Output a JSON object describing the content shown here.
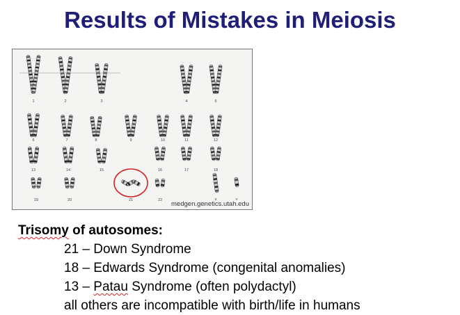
{
  "title": "Results of Mistakes in Meiosis",
  "figure": {
    "credit": "medgen.genetics.utah.edu",
    "chromosome_numbers": [
      "1",
      "2",
      "3",
      "4",
      "5",
      "6",
      "7",
      "8",
      "9",
      "10",
      "11",
      "12",
      "13",
      "14",
      "15",
      "16",
      "17",
      "18",
      "19",
      "20",
      "21",
      "22",
      "X",
      "Y"
    ],
    "highlight": {
      "chromosome": "21",
      "color": "#d42020"
    }
  },
  "text": {
    "heading_part1": "Trisomy",
    "heading_part2": " of autosomes:",
    "items": [
      {
        "prefix": "21 – Down Syndrome",
        "flagged": "",
        "suffix": ""
      },
      {
        "prefix": "18 – Edwards Syndrome (congenital anomalies)",
        "flagged": "",
        "suffix": ""
      },
      {
        "prefix": "13 – ",
        "flagged": "Patau",
        "suffix": " Syndrome (often polydactyl)"
      },
      {
        "prefix": "all others are incompatible with birth/life in humans",
        "flagged": "",
        "suffix": ""
      }
    ]
  },
  "colors": {
    "title": "#1f1f78",
    "spellcheck": "#d22"
  }
}
